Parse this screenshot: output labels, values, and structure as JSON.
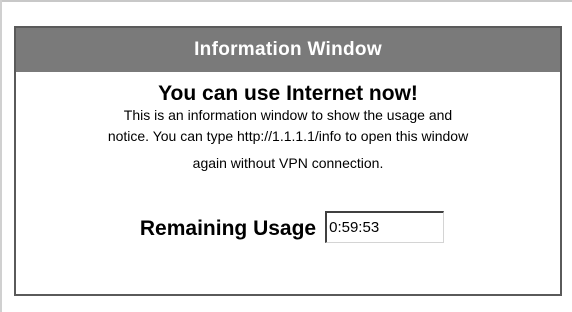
{
  "window": {
    "title": "Information Window"
  },
  "message": {
    "headline": "You can use Internet now!",
    "notice_line1": "This is an information window to show the usage and",
    "notice_line2": "notice. You can type http://1.1.1.1/info to open this window",
    "notice_line3": "again without VPN connection."
  },
  "usage": {
    "label": "Remaining Usage",
    "value": "0:59:53"
  },
  "colors": {
    "title_bar": "#7a7a7a",
    "title_text": "#ffffff",
    "panel_border": "#5a5a5a"
  }
}
